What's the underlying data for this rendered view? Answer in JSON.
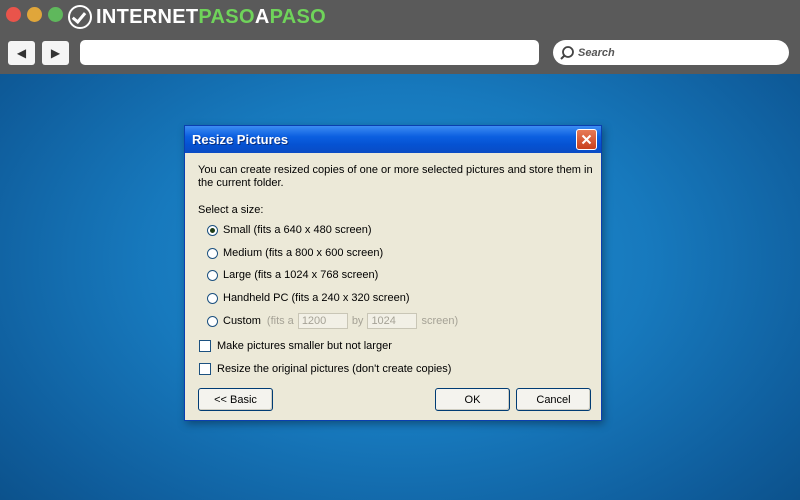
{
  "browser": {
    "logo": {
      "part1": "INTERNET",
      "part2": "PASO",
      "part3": "A",
      "part4": "PASO"
    },
    "search": {
      "label": "Search"
    },
    "nav": {
      "back": "◀",
      "forward": "▶"
    }
  },
  "dialog": {
    "title": "Resize Pictures",
    "intro": "You can create resized copies of one or more selected pictures and store them in the current folder.",
    "select_label": "Select a size:",
    "sizes": [
      {
        "label": "Small (fits a 640 x 480 screen)",
        "selected": true
      },
      {
        "label": "Medium (fits a 800 x 600 screen)",
        "selected": false
      },
      {
        "label": "Large (fits a 1024 x 768 screen)",
        "selected": false
      },
      {
        "label": "Handheld PC (fits a 240 x 320 screen)",
        "selected": false
      }
    ],
    "custom": {
      "label": "Custom",
      "prefix": "(fits a",
      "width": "1200",
      "by": "by",
      "height": "1024",
      "suffix": "screen)"
    },
    "options": [
      {
        "label": "Make pictures smaller but not larger",
        "checked": false
      },
      {
        "label": "Resize the original pictures (don't create copies)",
        "checked": false
      }
    ],
    "buttons": {
      "basic": "<< Basic",
      "ok": "OK",
      "cancel": "Cancel"
    }
  },
  "colors": {
    "desktop": "#1779bd",
    "titlebar": "#0552d2",
    "dialog_bg": "#ece9d8",
    "logo_green": "#6fd35a"
  }
}
